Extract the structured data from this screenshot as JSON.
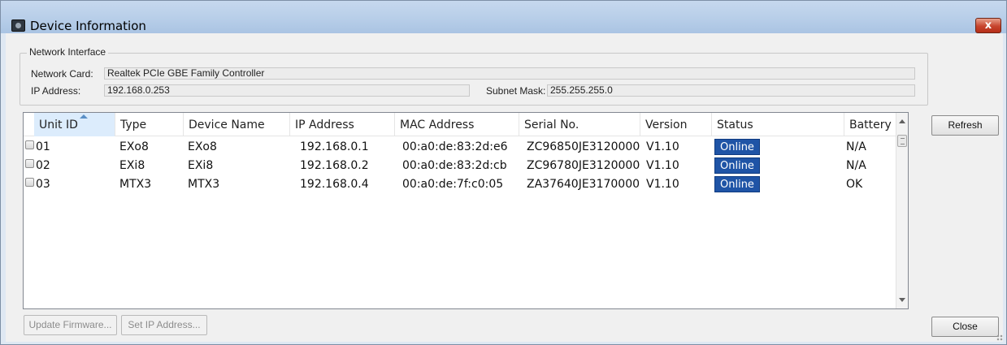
{
  "window": {
    "title": "Device Information",
    "close_label": "x"
  },
  "network_interface": {
    "legend": "Network Interface",
    "network_card_label": "Network Card:",
    "network_card_value": "Realtek PCIe GBE Family Controller",
    "ip_address_label": "IP Address:",
    "ip_address_value": "192.168.0.253",
    "subnet_mask_label": "Subnet Mask:",
    "subnet_mask_value": "255.255.255.0"
  },
  "table": {
    "columns": [
      "Unit ID",
      "Type",
      "Device Name",
      "IP Address",
      "MAC Address",
      "Serial No.",
      "Version",
      "Status",
      "Battery"
    ],
    "sorted_column": "Unit ID",
    "rows": [
      {
        "unit_id": "01",
        "type": "EXo8",
        "device_name": "EXo8",
        "ip": "192.168.0.1",
        "mac": "00:a0:de:83:2d:e6",
        "serial": "ZC96850JE3120000",
        "version": "V1.10",
        "status": "Online",
        "battery": "N/A"
      },
      {
        "unit_id": "02",
        "type": "EXi8",
        "device_name": "EXi8",
        "ip": "192.168.0.2",
        "mac": "00:a0:de:83:2d:cb",
        "serial": "ZC96780JE3120000",
        "version": "V1.10",
        "status": "Online",
        "battery": "N/A"
      },
      {
        "unit_id": "03",
        "type": "MTX3",
        "device_name": "MTX3",
        "ip": "192.168.0.4",
        "mac": "00:a0:de:7f:c0:05",
        "serial": "ZA37640JE3170000",
        "version": "V1.10",
        "status": "Online",
        "battery": "OK"
      }
    ]
  },
  "buttons": {
    "refresh": "Refresh",
    "close": "Close",
    "update_firmware": "Update Firmware...",
    "set_ip_address": "Set IP Address..."
  },
  "colors": {
    "status_online": "#1f54a6",
    "titlebar": "#b9cfe9",
    "close_button": "#c7442d"
  }
}
